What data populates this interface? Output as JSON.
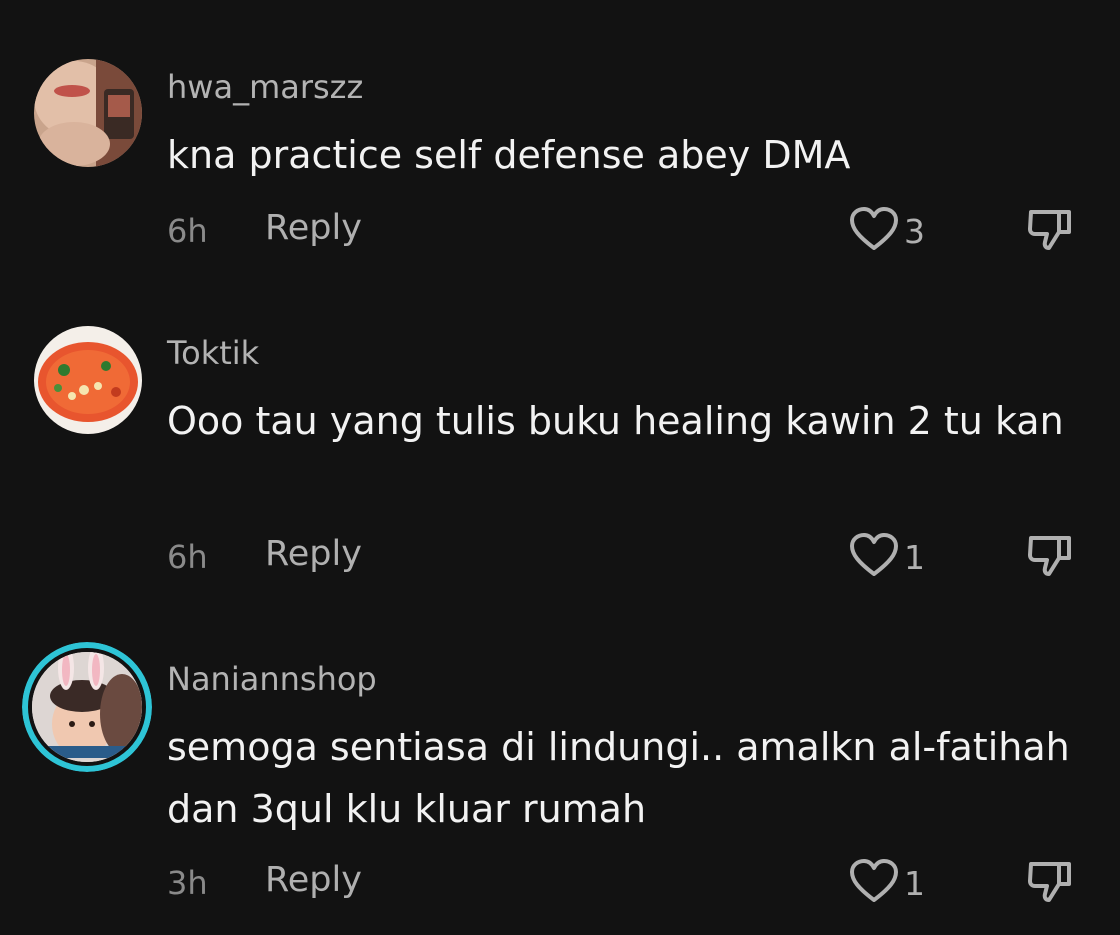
{
  "comments": [
    {
      "username": "hwa_marszz",
      "text": "kna practice self defense abey DMA",
      "time": "6h",
      "reply_label": "Reply",
      "like_count": "3"
    },
    {
      "username": "Toktik",
      "text": "Ooo tau yang tulis buku healing kawin 2 tu kan",
      "time": "6h",
      "reply_label": "Reply",
      "like_count": "1"
    },
    {
      "username": "Naniannshop",
      "text": "semoga sentiasa di lindungi.. amalkn al-fatihah dan 3qul klu kluar rumah",
      "time": "3h",
      "reply_label": "Reply",
      "like_count": "1",
      "avatar_ring_color": "#2ec4d6"
    }
  ],
  "icons": {
    "like": "heart-outline-icon",
    "dislike": "thumbs-down-outline-icon"
  }
}
